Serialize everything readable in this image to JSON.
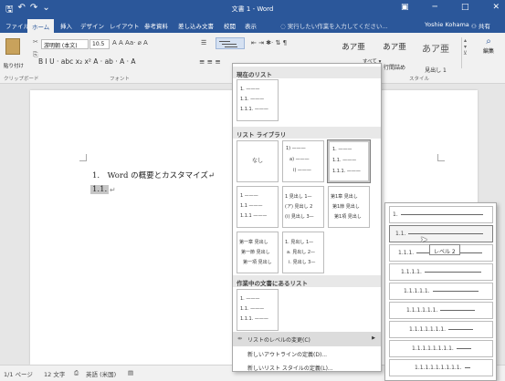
{
  "titlebar": {
    "title": "文書 1 - Word",
    "qat": {
      "save": "🖫",
      "undo": "↶",
      "redo": "↷",
      "customize": "⌄"
    },
    "controls": {
      "ribbon_opts": "▣",
      "minimize": "─",
      "maximize": "□",
      "close": "✕"
    }
  },
  "tabs": [
    "ファイル",
    "ホーム",
    "挿入",
    "デザイン",
    "レイアウト",
    "参考資料",
    "差し込み文書",
    "校閲",
    "表示"
  ],
  "active_tab": "ホーム",
  "tellme_text": "実行したい作業を入力してください...",
  "user_name": "Yoshie Kohama",
  "share_label": "共有",
  "ribbon": {
    "paste_label": "貼り付け",
    "font_name": "游明朝 (本文)",
    "font_size": "10.5",
    "font_row1": "A  A  Aa· ⌀  A",
    "font_row2": "B  I  U · abc x₂ x²  A · ab · A · A",
    "para_row2": "≡  ≡  ≡",
    "groups": {
      "clipboard": "クリップボード",
      "font": "フォント",
      "styles": "スタイル"
    },
    "styles": [
      {
        "sample": "あア亜",
        "name": "標準"
      },
      {
        "sample": "あア亜",
        "name": "行間詰め"
      },
      {
        "sample": "あア亜",
        "name": "見出し 1"
      }
    ],
    "styles_more": "すべて ▾",
    "editing_label": "編集"
  },
  "document": {
    "line1": "1.　Word の概要とカスタマイズ↵",
    "line2": "1.1.",
    "cursor_mark": "↵"
  },
  "statusbar": {
    "page": "1/1 ページ",
    "words": "12 文字",
    "lang": "英語 (米国)"
  },
  "dropdown": {
    "current_list_head": "現在のリスト",
    "library_head": "リスト ライブラリ",
    "in_doc_head": "作業中の文書にあるリスト",
    "none_label": "なし",
    "library_thumbs": [
      {
        "lines": [
          "1) ———",
          "a) ———",
          "i) ———"
        ]
      },
      {
        "lines": [
          "1. ———",
          "1.1. ———",
          "1.1.1. ———"
        ]
      },
      {
        "lines": [
          "• ———",
          "➢ ———",
          "▪ ———"
        ]
      },
      {
        "lines": [
          "1 ———",
          "1.1 ———",
          "1.1.1 ———"
        ]
      },
      {
        "lines": [
          "1 見出し 1—",
          "(ア) 見出し 2",
          "(i) 見出し 3—"
        ]
      },
      {
        "lines": [
          "第1章 見出し",
          "第1節 見出し",
          "第1項 見出し"
        ]
      },
      {
        "lines": [
          "第一章 見出し",
          "第一節 見出し",
          "第一項 見出し"
        ]
      },
      {
        "lines": [
          "1. 見出し 1—",
          "a. 見出し 2—",
          "i. 見出し 3—"
        ]
      }
    ],
    "current_list_lines": [
      "1. ———",
      "1.1. ———",
      "1.1.1. ———"
    ],
    "in_doc_lines": [
      "1. ———",
      "1.1. ———",
      "1.1.1. ———"
    ],
    "change_level": "リストのレベルの変更(C)",
    "define_new_list": "新しいアウトラインの定義(D)...",
    "define_new_style": "新しいリスト スタイルの定義(L)..."
  },
  "submenu": {
    "levels": [
      "1.",
      "1.1.",
      "1.1.1.",
      "1.1.1.1.",
      "1.1.1.1.1.",
      "1.1.1.1.1.1.",
      "1.1.1.1.1.1.1.",
      "1.1.1.1.1.1.1.1.",
      "1.1.1.1.1.1.1.1.1."
    ],
    "tooltip": "レベル 2"
  }
}
